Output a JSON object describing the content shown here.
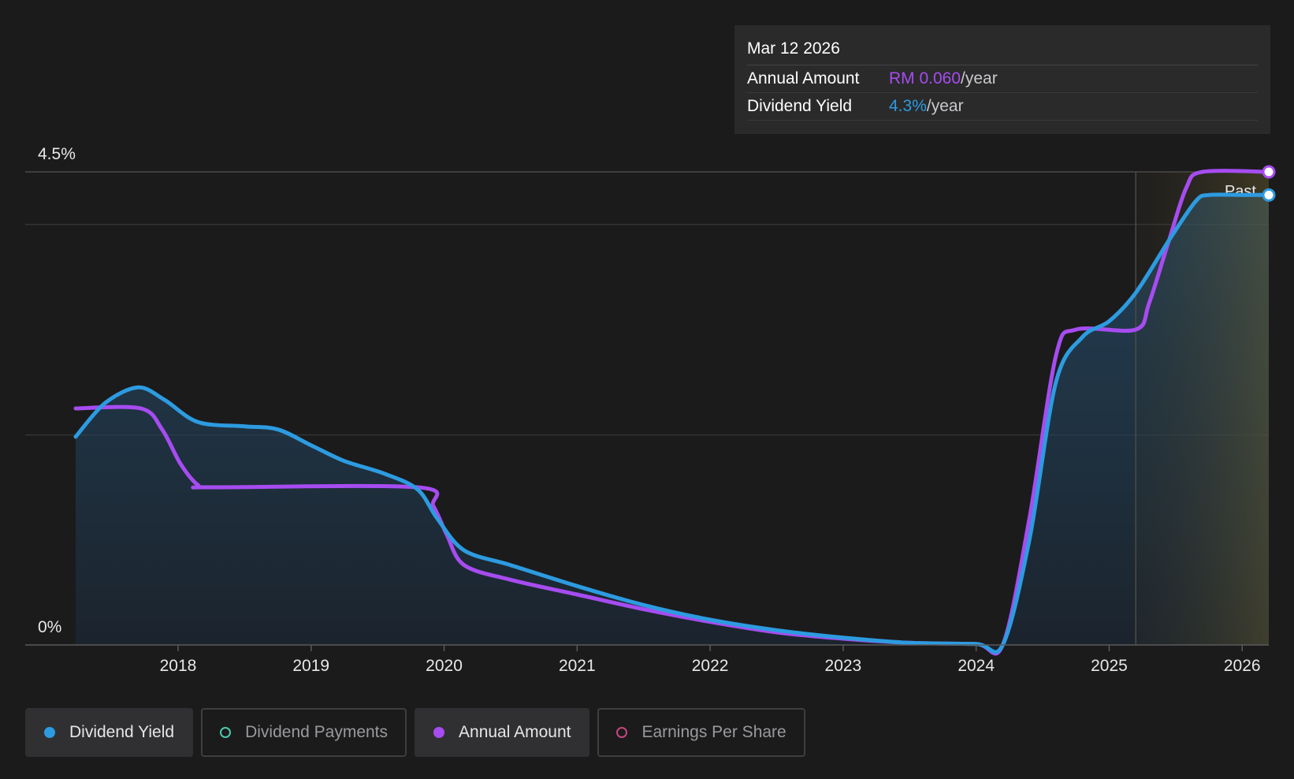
{
  "tooltip": {
    "date": "Mar 12 2026",
    "rows": [
      {
        "label": "Annual Amount",
        "value": "RM 0.060",
        "suffix": "/year",
        "color": "#a64cf0"
      },
      {
        "label": "Dividend Yield",
        "value": "4.3%",
        "suffix": "/year",
        "color": "#2d9be0"
      }
    ]
  },
  "legend": [
    {
      "label": "Dividend Yield",
      "color": "#2d9be0",
      "filled": true,
      "active": true
    },
    {
      "label": "Dividend Payments",
      "color": "#4fc9b0",
      "filled": false,
      "active": false
    },
    {
      "label": "Annual Amount",
      "color": "#a64cf0",
      "filled": true,
      "active": true
    },
    {
      "label": "Earnings Per Share",
      "color": "#c8457f",
      "filled": false,
      "active": false
    }
  ],
  "chart_data": {
    "type": "line",
    "y_axis_labels": [
      "4.5%",
      "0%"
    ],
    "ylim": [
      0,
      4.5
    ],
    "xlim": [
      2017.23,
      2026.2
    ],
    "x_ticks": [
      2018,
      2019,
      2020,
      2021,
      2022,
      2023,
      2024,
      2025,
      2026
    ],
    "past_marker": {
      "x": 2025.2,
      "label": "Past"
    },
    "series": [
      {
        "name": "Dividend Yield",
        "color": "#2d9be0",
        "filled": true,
        "points": [
          [
            2017.23,
            1.98
          ],
          [
            2017.45,
            2.3
          ],
          [
            2017.7,
            2.45
          ],
          [
            2017.9,
            2.33
          ],
          [
            2018.15,
            2.12
          ],
          [
            2018.5,
            2.08
          ],
          [
            2018.75,
            2.05
          ],
          [
            2019.0,
            1.9
          ],
          [
            2019.25,
            1.75
          ],
          [
            2019.55,
            1.63
          ],
          [
            2019.8,
            1.48
          ],
          [
            2019.95,
            1.2
          ],
          [
            2020.15,
            0.9
          ],
          [
            2020.5,
            0.76
          ],
          [
            2021.0,
            0.56
          ],
          [
            2021.5,
            0.38
          ],
          [
            2022.0,
            0.24
          ],
          [
            2022.5,
            0.14
          ],
          [
            2023.0,
            0.07
          ],
          [
            2023.5,
            0.02
          ],
          [
            2024.0,
            0.01
          ],
          [
            2024.2,
            0.0
          ],
          [
            2024.4,
            1.0
          ],
          [
            2024.6,
            2.5
          ],
          [
            2024.8,
            2.93
          ],
          [
            2025.0,
            3.08
          ],
          [
            2025.2,
            3.35
          ],
          [
            2025.45,
            3.85
          ],
          [
            2025.65,
            4.22
          ],
          [
            2025.75,
            4.28
          ],
          [
            2026.0,
            4.28
          ],
          [
            2026.2,
            4.28
          ]
        ]
      },
      {
        "name": "Annual Amount",
        "color": "#a64cf0",
        "filled": false,
        "points": [
          [
            2017.23,
            2.25
          ],
          [
            2017.72,
            2.25
          ],
          [
            2017.88,
            2.05
          ],
          [
            2018.02,
            1.72
          ],
          [
            2018.15,
            1.52
          ],
          [
            2018.25,
            1.5
          ],
          [
            2019.8,
            1.5
          ],
          [
            2019.92,
            1.32
          ],
          [
            2020.02,
            1.05
          ],
          [
            2020.15,
            0.76
          ],
          [
            2020.5,
            0.62
          ],
          [
            2021.0,
            0.48
          ],
          [
            2021.5,
            0.34
          ],
          [
            2022.0,
            0.22
          ],
          [
            2022.5,
            0.12
          ],
          [
            2023.0,
            0.06
          ],
          [
            2023.5,
            0.02
          ],
          [
            2024.0,
            0.01
          ],
          [
            2024.2,
            0.0
          ],
          [
            2024.4,
            1.2
          ],
          [
            2024.6,
            2.75
          ],
          [
            2024.75,
            3.0
          ],
          [
            2025.2,
            3.0
          ],
          [
            2025.3,
            3.25
          ],
          [
            2025.45,
            3.85
          ],
          [
            2025.58,
            4.35
          ],
          [
            2025.7,
            4.5
          ],
          [
            2026.2,
            4.5
          ]
        ]
      }
    ]
  }
}
